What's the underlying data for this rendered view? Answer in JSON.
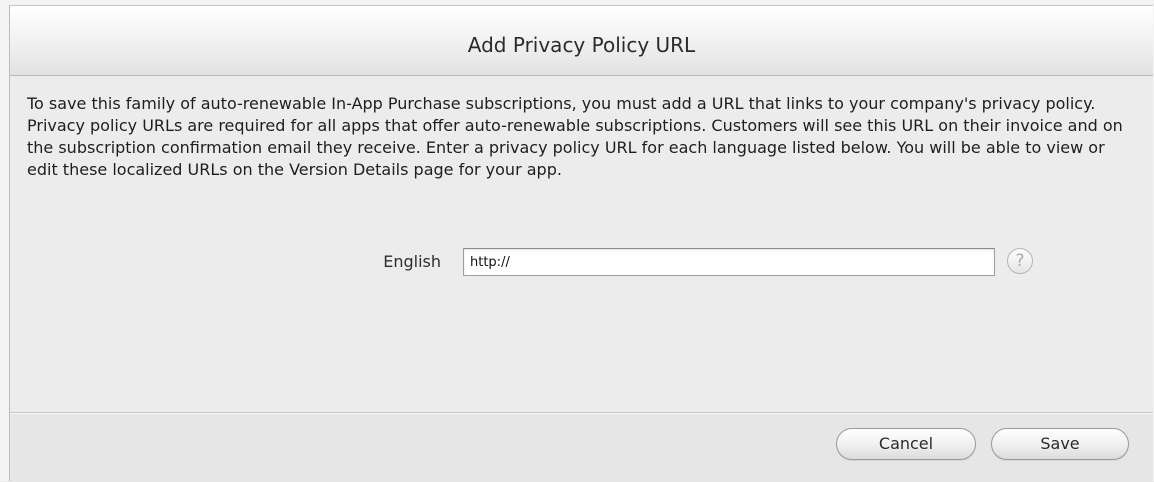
{
  "dialog": {
    "title": "Add Privacy Policy URL",
    "message": "To save this family of auto-renewable In-App Purchase subscriptions, you must add a URL that links to your company's privacy policy. Privacy policy URLs are required for all apps that offer auto-renewable subscriptions. Customers will see this URL on their invoice and on the subscription confirmation email they receive. Enter a privacy policy URL for each language listed below. You will be able to view or edit these localized URLs on the Version Details page for your app.",
    "field": {
      "label": "English",
      "value": "http://"
    },
    "help": {
      "icon": "question-mark-icon",
      "glyph": "?"
    },
    "buttons": {
      "cancel": "Cancel",
      "save": "Save"
    }
  }
}
